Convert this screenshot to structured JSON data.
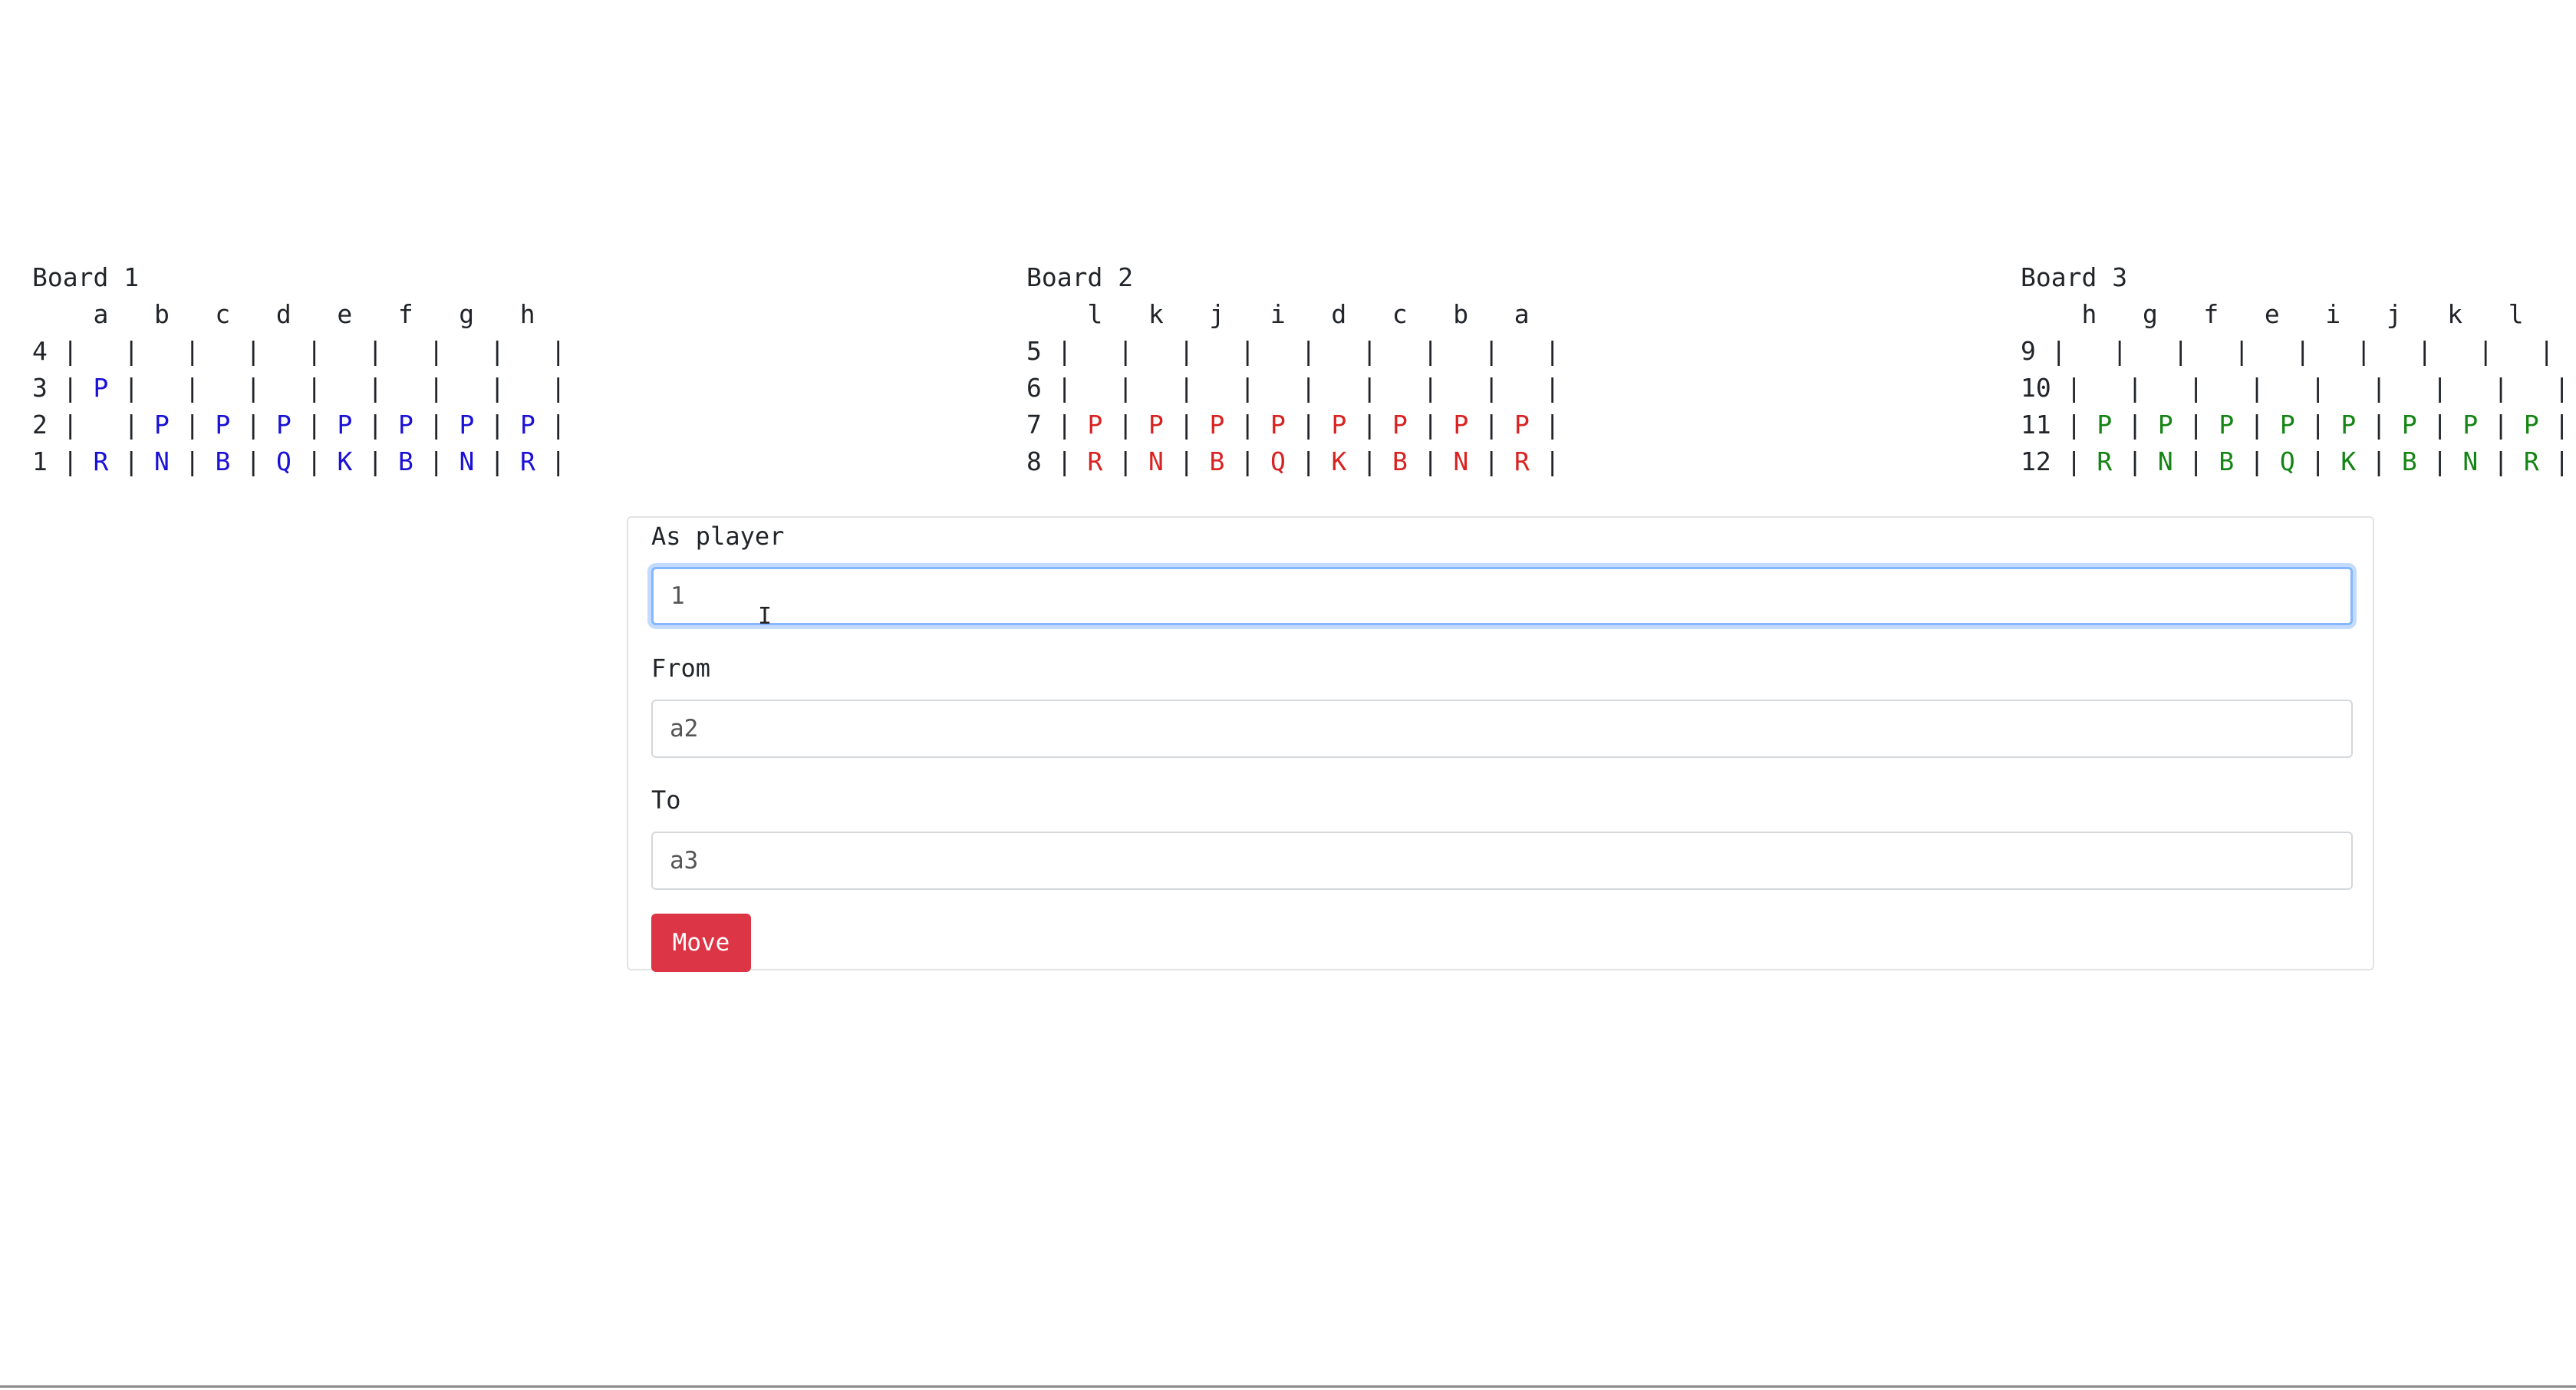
{
  "boards": [
    {
      "title": "Board 1",
      "header": "    a   b   c   d   e   f   g   h",
      "color": "#1a11d6",
      "rows": [
        {
          "label": "4",
          "cells": [
            "",
            "",
            "",
            "",
            "",
            "",
            "",
            ""
          ]
        },
        {
          "label": "3",
          "cells": [
            "P",
            "",
            "",
            "",
            "",
            "",
            "",
            ""
          ]
        },
        {
          "label": "2",
          "cells": [
            "",
            "P",
            "P",
            "P",
            "P",
            "P",
            "P",
            "P"
          ]
        },
        {
          "label": "1",
          "cells": [
            "R",
            "N",
            "B",
            "Q",
            "K",
            "B",
            "N",
            "R"
          ]
        }
      ]
    },
    {
      "title": "Board 2",
      "header": "    l   k   j   i   d   c   b   a",
      "color": "#d92222",
      "rows": [
        {
          "label": "5",
          "cells": [
            "",
            "",
            "",
            "",
            "",
            "",
            "",
            ""
          ]
        },
        {
          "label": "6",
          "cells": [
            "",
            "",
            "",
            "",
            "",
            "",
            "",
            ""
          ]
        },
        {
          "label": "7",
          "cells": [
            "P",
            "P",
            "P",
            "P",
            "P",
            "P",
            "P",
            "P"
          ]
        },
        {
          "label": "8",
          "cells": [
            "R",
            "N",
            "B",
            "Q",
            "K",
            "B",
            "N",
            "R"
          ]
        }
      ]
    },
    {
      "title": "Board 3",
      "header": "    h   g   f   e   i   j   k   l",
      "color": "#148414",
      "rows": [
        {
          "label": "9",
          "cells": [
            "",
            "",
            "",
            "",
            "",
            "",
            "",
            ""
          ]
        },
        {
          "label": "10",
          "cells": [
            "",
            "",
            "",
            "",
            "",
            "",
            "",
            ""
          ]
        },
        {
          "label": "11",
          "cells": [
            "P",
            "P",
            "P",
            "P",
            "P",
            "P",
            "P",
            "P"
          ]
        },
        {
          "label": "12",
          "cells": [
            "R",
            "N",
            "B",
            "Q",
            "K",
            "B",
            "N",
            "R"
          ]
        }
      ]
    }
  ],
  "form": {
    "player_label": "As player",
    "player_value": "1",
    "from_label": "From",
    "from_value": "a2",
    "to_label": "To",
    "to_value": "a3",
    "move_label": "Move",
    "button_color": "#dc3545"
  },
  "cursor": {
    "icon": "text-cursor-icon"
  }
}
